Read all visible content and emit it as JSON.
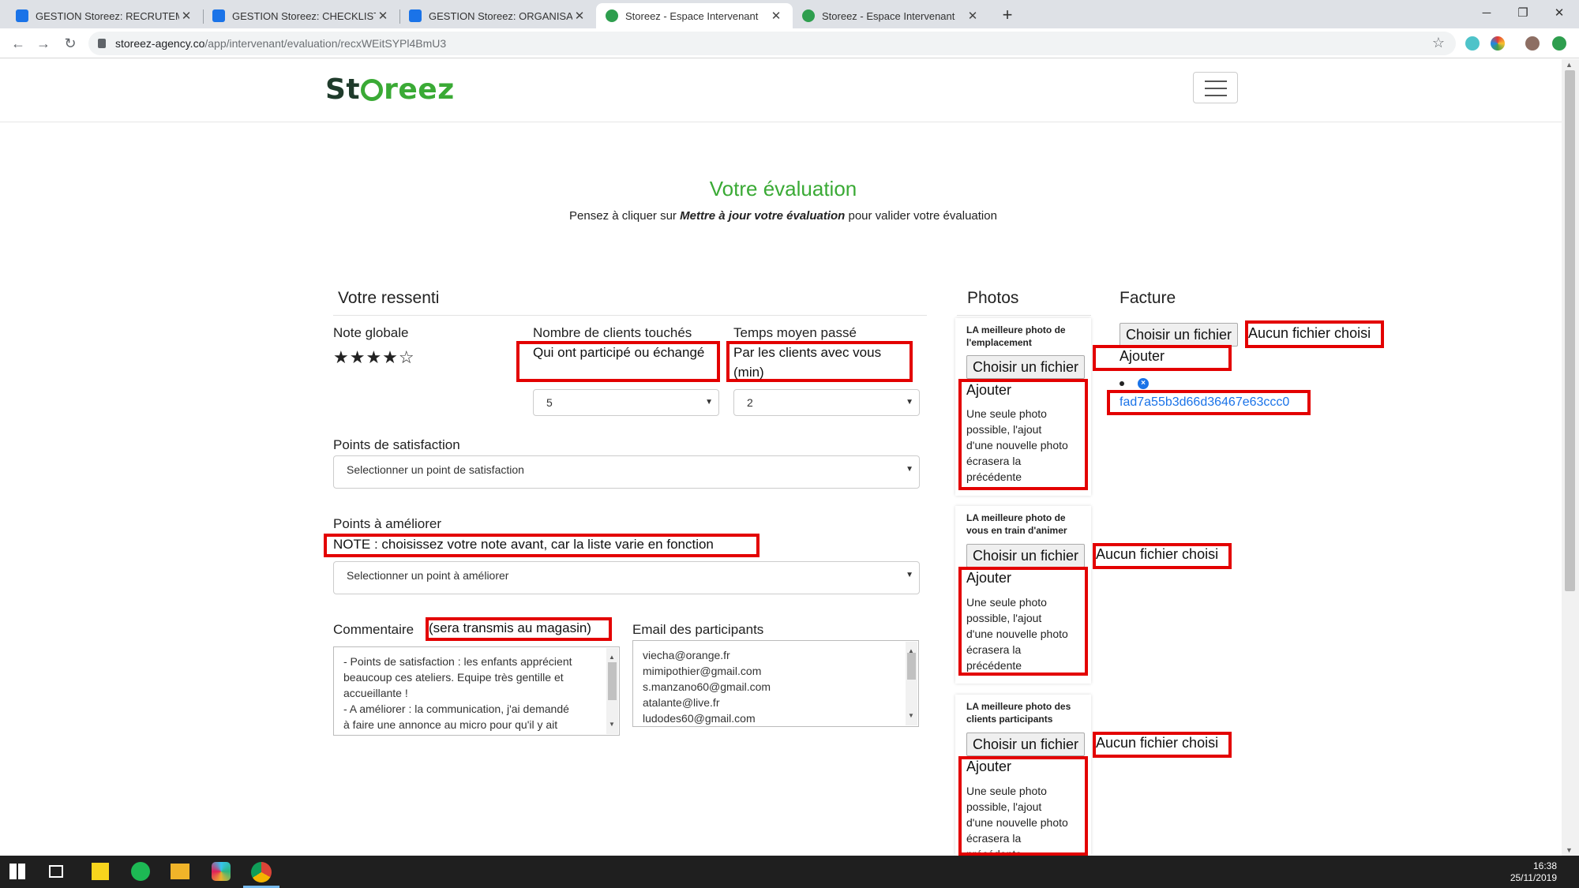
{
  "browser": {
    "tabs": [
      {
        "title": "GESTION Storeez: RECRUTEMENT",
        "icon": "tasks-icon"
      },
      {
        "title": "GESTION Storeez: CHECKLISTS OP",
        "icon": "tasks-icon"
      },
      {
        "title": "GESTION Storeez: ORGANISATION",
        "icon": "tasks-icon"
      },
      {
        "title": "Storeez - Espace Intervenant",
        "icon": "storeez-icon"
      },
      {
        "title": "Storeez - Espace Intervenant",
        "icon": "storeez-icon"
      }
    ],
    "active_tab": 3,
    "url_host": "storeez-agency.co",
    "url_path": "/app/intervenant/evaluation/recxWEitSYPl4BmU3"
  },
  "site": {
    "logo_left": "St",
    "logo_right": "reez",
    "brand_color": "#3aaa35"
  },
  "page": {
    "title": "Votre évaluation",
    "subtitle_before": "Pensez à cliquer sur ",
    "subtitle_em": "Mettre à jour votre évaluation",
    "subtitle_after": " pour valider votre évaluation"
  },
  "ressenti": {
    "title": "Votre ressenti",
    "note_globale_label": "Note globale",
    "stars": "★★★★☆",
    "rating": 4,
    "clients_label": "Nombre de clients touchés",
    "clients_note": "Qui ont participé ou échangé",
    "clients_value": "5",
    "temps_label": "Temps moyen passé",
    "temps_note": "Par les clients avec vous (min)",
    "temps_value": "2",
    "satisfaction_label": "Points de satisfaction",
    "satisfaction_placeholder": "Selectionner un point de satisfaction",
    "ameliorer_label": "Points à améliorer",
    "ameliorer_note": "NOTE : choisissez votre note avant, car la liste varie en fonction",
    "ameliorer_placeholder": "Selectionner un point à améliorer",
    "commentaire_label": "Commentaire",
    "commentaire_note": "(sera transmis au magasin)",
    "commentaire_lines": [
      "- Points de satisfaction : les enfants apprécient",
      "beaucoup ces ateliers. Equipe très gentille et",
      "accueillante !",
      "- A améliorer : la communication, j'ai demandé",
      "à faire une annonce au micro pour qu'il y ait"
    ],
    "email_label": "Email des participants",
    "emails": [
      "viecha@orange.fr",
      "mimipothier@gmail.com",
      "s.manzano60@gmail.com",
      "atalante@live.fr",
      "ludodes60@gmail.com"
    ]
  },
  "photos": {
    "title": "Photos",
    "cards": [
      {
        "label_line1": "LA meilleure photo de",
        "label_line2": "l'emplacement"
      },
      {
        "label_line1": "LA meilleure photo de",
        "label_line2": "vous en train d'animer"
      },
      {
        "label_line1": "LA meilleure photo des",
        "label_line2": "clients participants"
      }
    ],
    "choose_file": "Choisir un fichier",
    "no_file": "Aucun fichier choisi",
    "add": "Ajouter",
    "hint_lines": [
      "Une seule photo",
      "possible, l'ajout",
      "d'une nouvelle photo",
      "écrasera la",
      "précédente"
    ]
  },
  "facture": {
    "title": "Facture",
    "choose_file": "Choisir un fichier",
    "no_file": "Aucun fichier choisi",
    "add": "Ajouter",
    "uploaded_file": "fad7a55b3d66d36467e63ccc0"
  },
  "taskbar": {
    "time": "16:38",
    "date": "25/11/2019"
  }
}
